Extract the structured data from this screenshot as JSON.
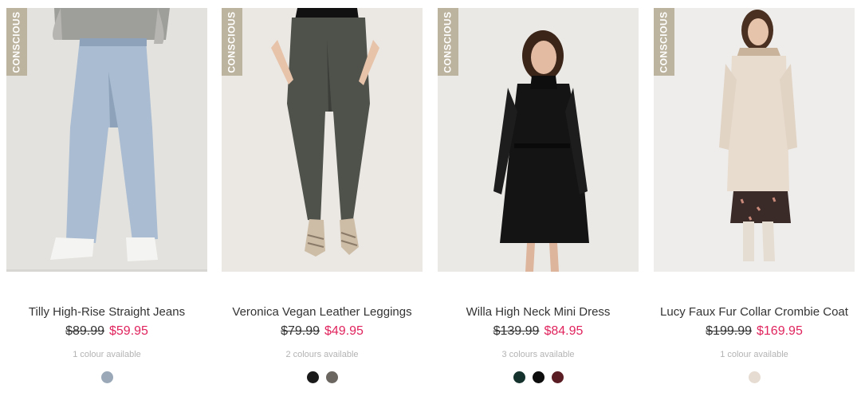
{
  "products": [
    {
      "badge": "CONSCIOUS",
      "name": "Tilly High-Rise Straight Jeans",
      "was_price": "$89.99",
      "now_price": "$59.95",
      "colours_text": "1 colour available",
      "swatches": [
        "#9aa8b8"
      ]
    },
    {
      "badge": "CONSCIOUS",
      "name": "Veronica Vegan Leather Leggings",
      "was_price": "$79.99",
      "now_price": "$49.95",
      "colours_text": "2 colours available",
      "swatches": [
        "#1a1a1a",
        "#6b6660"
      ]
    },
    {
      "badge": "CONSCIOUS",
      "name": "Willa High Neck Mini Dress",
      "was_price": "$139.99",
      "now_price": "$84.95",
      "colours_text": "3 colours available",
      "swatches": [
        "#15322d",
        "#0d0d0d",
        "#5a1d24"
      ]
    },
    {
      "badge": "CONSCIOUS",
      "name": "Lucy Faux Fur Collar Crombie Coat",
      "was_price": "$199.99",
      "now_price": "$169.95",
      "colours_text": "1 colour available",
      "swatches": [
        "#e6dcd2"
      ]
    }
  ],
  "colors": {
    "badge_bg": "#bdb49f",
    "sale_price": "#e0245e",
    "muted_text": "#b3b3b3"
  }
}
